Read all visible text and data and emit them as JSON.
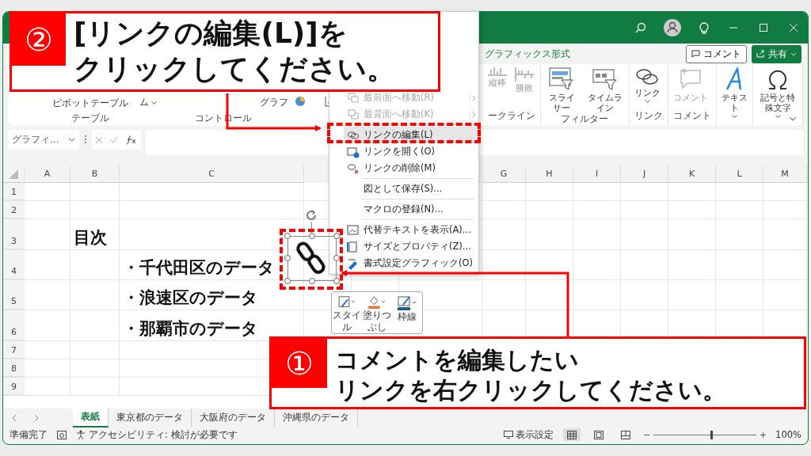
{
  "ribbon": {
    "contextual_tab": "グラフィックス形式",
    "comment_button": "コメント",
    "share_button": "共有",
    "left_items": [
      {
        "label": "ピボットテーブル"
      },
      {
        "label": "ム",
        "dropdown": true
      },
      {
        "label": "グラフ"
      }
    ],
    "left_group_labels": [
      "テーブル",
      "コントロール"
    ],
    "groups": [
      {
        "label": "ークライン",
        "items": [
          {
            "label": "縦棒",
            "disabled": true,
            "dropdown": false
          },
          {
            "label": "勝敗",
            "disabled": true,
            "dropdown": false
          }
        ]
      },
      {
        "label": "フィルター",
        "items": [
          {
            "label": "スライサー",
            "disabled": false,
            "dropdown": false
          },
          {
            "label": "タイムライン",
            "disabled": false,
            "dropdown": false
          }
        ]
      },
      {
        "label": "リンク",
        "items": [
          {
            "label": "リンク",
            "disabled": false,
            "dropdown": true
          }
        ]
      },
      {
        "label": "コメント",
        "items": [
          {
            "label": "コメント",
            "disabled": true,
            "dropdown": false
          }
        ]
      },
      {
        "items": [
          {
            "label": "テキスト",
            "disabled": false,
            "dropdown": true
          }
        ]
      },
      {
        "items": [
          {
            "label": "記号と特殊文字",
            "disabled": false,
            "dropdown": true
          }
        ]
      }
    ]
  },
  "formula_bar": {
    "name_box": "グラフィ..."
  },
  "sheet": {
    "columns": [
      "A",
      "B",
      "C",
      "G",
      "H",
      "I",
      "J",
      "K",
      "L",
      "M"
    ],
    "rows": [
      {
        "number": "1"
      },
      {
        "number": "2"
      },
      {
        "number": "3",
        "cells": {
          "B": "目次"
        }
      },
      {
        "number": "4",
        "cells": {
          "C": "・千代田区のデータ"
        }
      },
      {
        "number": "5",
        "cells": {
          "C": "・浪速区のデータ"
        }
      },
      {
        "number": "6",
        "cells": {
          "C": "・那覇市のデータ"
        }
      },
      {
        "number": "7"
      },
      {
        "number": "8"
      },
      {
        "number": "9"
      }
    ]
  },
  "sheet_tabs": [
    {
      "label": "表紙",
      "selected": true
    },
    {
      "label": "東京都のデータ",
      "selected": false
    },
    {
      "label": "大阪府のデータ",
      "selected": false
    },
    {
      "label": "沖縄県のデータ",
      "selected": false
    }
  ],
  "status_bar": {
    "ready": "準備完了",
    "accessibility": "アクセシビリティ: 検討が必要です",
    "display_settings": "表示設定",
    "views": [
      {
        "selected": true
      },
      {
        "selected": false
      },
      {
        "selected": false
      }
    ],
    "zoom_slider": {
      "level": 0.55
    },
    "zoom": "100%"
  },
  "context_menu": {
    "items": [
      {
        "kind": "item",
        "label": "最前面へ移動(R)",
        "disabled": true,
        "submenu": true,
        "selected": false
      },
      {
        "kind": "item",
        "label": "最背面へ移動(K)",
        "disabled": true,
        "submenu": true,
        "selected": false
      },
      {
        "kind": "separator"
      },
      {
        "kind": "item",
        "label": "リンクの編集(L)",
        "disabled": false,
        "submenu": false,
        "selected": true
      },
      {
        "kind": "item",
        "label": "リンクを開く(O)",
        "disabled": false,
        "submenu": false,
        "selected": false
      },
      {
        "kind": "item",
        "label": "リンクの削除(M)",
        "disabled": false,
        "submenu": false,
        "selected": false
      },
      {
        "kind": "separator"
      },
      {
        "kind": "item",
        "label": "図として保存(S)...",
        "disabled": false,
        "submenu": false,
        "selected": false
      },
      {
        "kind": "separator"
      },
      {
        "kind": "item",
        "label": "マクロの登録(N)...",
        "disabled": false,
        "submenu": false,
        "selected": false
      },
      {
        "kind": "separator"
      },
      {
        "kind": "item",
        "label": "代替テキストを表示(A)...",
        "disabled": false,
        "submenu": false,
        "selected": false
      },
      {
        "kind": "item",
        "label": "サイズとプロパティ(Z)...",
        "disabled": false,
        "submenu": false,
        "selected": false
      },
      {
        "kind": "item",
        "label": "書式設定グラフィック(O)",
        "disabled": false,
        "submenu": false,
        "selected": false
      }
    ]
  },
  "mini_toolbar": [
    {
      "label": "スタイル"
    },
    {
      "label": "塗りつぶし"
    },
    {
      "label": "枠線"
    }
  ],
  "callouts": [
    {
      "number": "②",
      "lines": [
        "[リンクの編集(L)]を",
        "クリックしてください。"
      ]
    },
    {
      "number": "①",
      "lines": [
        "コメントを編集したい",
        "リンクを右クリックしてください。"
      ]
    }
  ]
}
